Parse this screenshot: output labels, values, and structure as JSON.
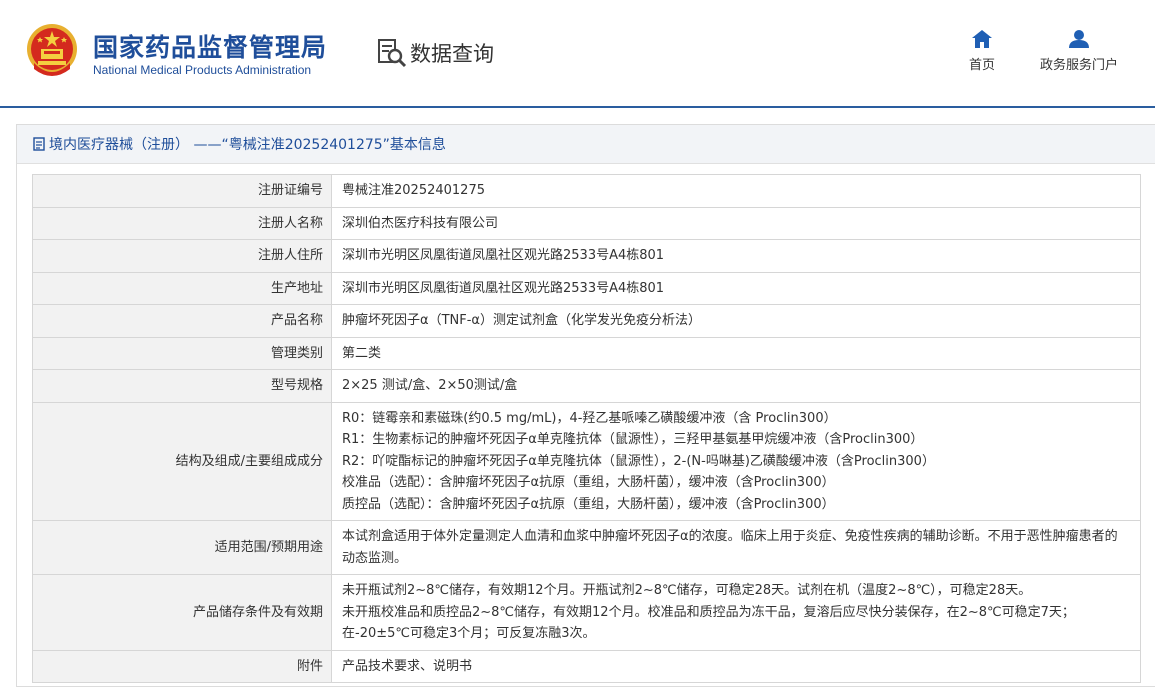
{
  "header": {
    "org_name_cn": "国家药品监督管理局",
    "org_name_en": "National Medical Products Administration",
    "section_label": "数据查询",
    "nav": [
      {
        "label": "首页",
        "icon": "home-icon"
      },
      {
        "label": "政务服务门户",
        "icon": "user-icon"
      }
    ]
  },
  "panel": {
    "title": "境内医疗器械（注册） ——“粤械注准20252401275”基本信息"
  },
  "rows": [
    {
      "label": "注册证编号",
      "lines": [
        "粤械注准20252401275"
      ]
    },
    {
      "label": "注册人名称",
      "lines": [
        "深圳伯杰医疗科技有限公司"
      ]
    },
    {
      "label": "注册人住所",
      "lines": [
        "深圳市光明区凤凰街道凤凰社区观光路2533号A4栋801"
      ]
    },
    {
      "label": "生产地址",
      "lines": [
        "深圳市光明区凤凰街道凤凰社区观光路2533号A4栋801"
      ]
    },
    {
      "label": "产品名称",
      "lines": [
        "肿瘤坏死因子α（TNF-α）测定试剂盒（化学发光免疫分析法）"
      ]
    },
    {
      "label": "管理类别",
      "lines": [
        "第二类"
      ]
    },
    {
      "label": "型号规格",
      "lines": [
        "2×25 测试/盒、2×50测试/盒"
      ]
    },
    {
      "label": "结构及组成/主要组成成分",
      "lines": [
        "R0：链霉亲和素磁珠(约0.5 mg/mL)，4-羟乙基哌嗪乙磺酸缓冲液（含 Proclin300）",
        "R1：生物素标记的肿瘤坏死因子α单克隆抗体（鼠源性），三羟甲基氨基甲烷缓冲液（含Proclin300）",
        "R2：吖啶酯标记的肿瘤坏死因子α单克隆抗体（鼠源性），2-(N-吗啉基)乙磺酸缓冲液（含Proclin300）",
        "校准品（选配）：含肿瘤坏死因子α抗原（重组，大肠杆菌），缓冲液（含Proclin300）",
        "质控品（选配）：含肿瘤坏死因子α抗原（重组，大肠杆菌），缓冲液（含Proclin300）"
      ]
    },
    {
      "label": "适用范围/预期用途",
      "lines": [
        "本试剂盒适用于体外定量测定人血清和血浆中肿瘤坏死因子α的浓度。临床上用于炎症、免疫性疾病的辅助诊断。不用于恶性肿瘤患者的动态监测。"
      ]
    },
    {
      "label": "产品储存条件及有效期",
      "lines": [
        "未开瓶试剂2~8℃储存，有效期12个月。开瓶试剂2~8℃储存，可稳定28天。试剂在机（温度2~8℃），可稳定28天。",
        "未开瓶校准品和质控品2~8℃储存，有效期12个月。校准品和质控品为冻干品，复溶后应尽快分装保存，在2~8℃可稳定7天；在-20±5℃可稳定3个月；可反复冻融3次。"
      ]
    },
    {
      "label": "附件",
      "lines": [
        "产品技术要求、说明书"
      ]
    }
  ]
}
